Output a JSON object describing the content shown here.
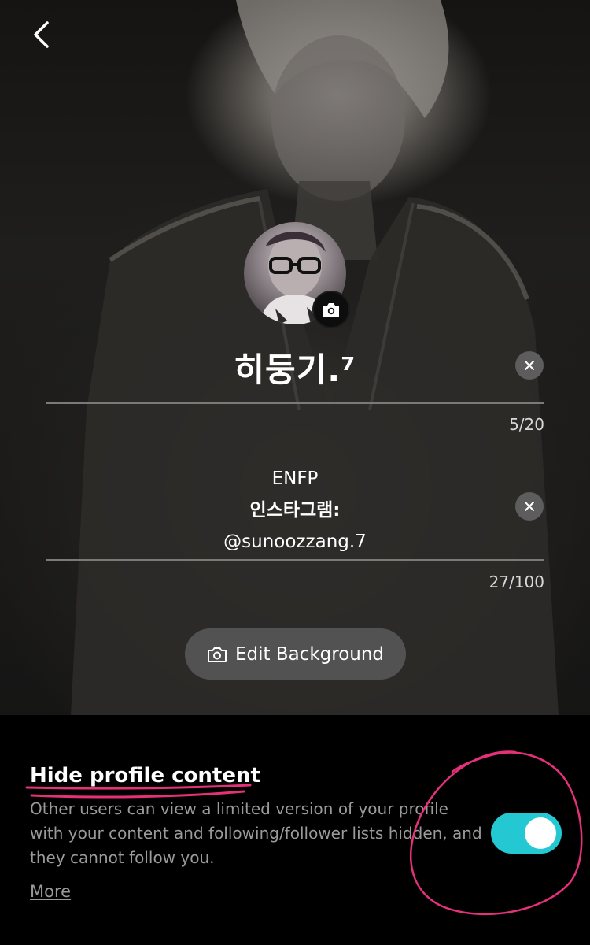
{
  "profile": {
    "name": "히둥기.⁷",
    "name_counter": "5/20",
    "bio_lines": [
      "ENFP",
      "인스타그램:",
      "@sunoozzang.7"
    ],
    "bio_counter": "27/100"
  },
  "actions": {
    "edit_background_label": "Edit Background"
  },
  "privacy": {
    "title": "Hide profile content",
    "description": "Other users can view a limited version of your profile with your content and following/follower lists hidden, and they cannot follow you.",
    "more_label": "More",
    "toggle_on": true
  },
  "icons": {
    "back": "chevron-left-icon",
    "camera": "camera-icon",
    "clear": "close-icon"
  },
  "colors": {
    "toggle_on": "#23c8d2",
    "annotation": "#e6307a"
  }
}
